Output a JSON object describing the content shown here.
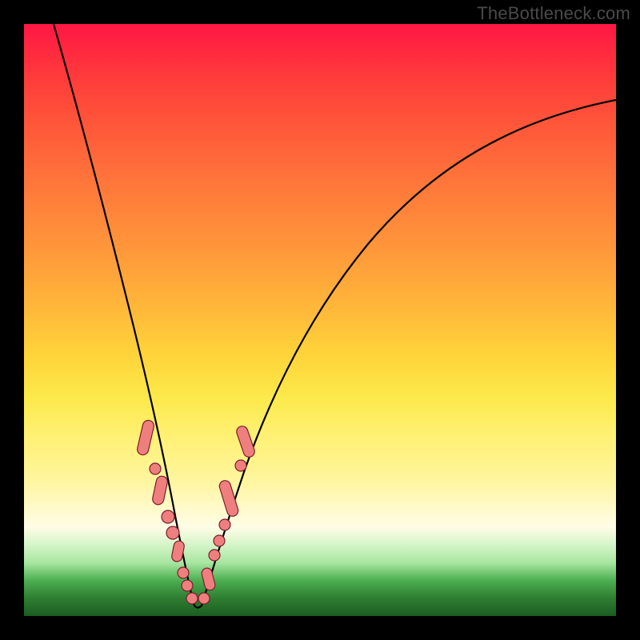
{
  "watermark": "TheBottleneck.com",
  "colors": {
    "frame_black": "#000000",
    "curve_stroke": "#000000",
    "marker_fill": "#ef7f7f",
    "gradient_top": "#ff1744",
    "gradient_mid": "#ffd43a",
    "gradient_low": "#fff59d",
    "gradient_green": "#2e7d32"
  },
  "chart_data": {
    "type": "line",
    "title": "",
    "xlabel": "",
    "ylabel": "",
    "xlim": [
      0,
      100
    ],
    "ylim": [
      0,
      100
    ],
    "note": "Axes are not labeled in the image; values are normalized 0–100 estimates read from pixel positions. y is the height of the curve (0 at bottom/green, 100 at top/red).",
    "series": [
      {
        "name": "left-branch",
        "x": [
          5,
          7,
          9,
          11,
          13,
          15,
          17,
          19,
          21,
          22.5,
          24,
          25.5,
          27,
          28,
          28.8
        ],
        "y": [
          100,
          92,
          83,
          74,
          65,
          56,
          47,
          38,
          29,
          22,
          16,
          11,
          7,
          4,
          2
        ]
      },
      {
        "name": "right-branch",
        "x": [
          29.5,
          30.5,
          32,
          34,
          37,
          41,
          46,
          52,
          58,
          65,
          72,
          79,
          86,
          93,
          100
        ],
        "y": [
          2,
          4,
          8,
          14,
          22,
          32,
          42,
          51,
          59,
          66,
          72,
          77,
          81,
          84,
          87
        ]
      }
    ],
    "markers": {
      "comment": "Salmon pill/bead markers clustered near the valley on both branches",
      "left_cluster": {
        "x_range": [
          19.5,
          28.5
        ],
        "y_range": [
          3,
          30
        ]
      },
      "right_cluster": {
        "x_range": [
          29.5,
          36.5
        ],
        "y_range": [
          3,
          26
        ]
      }
    }
  }
}
